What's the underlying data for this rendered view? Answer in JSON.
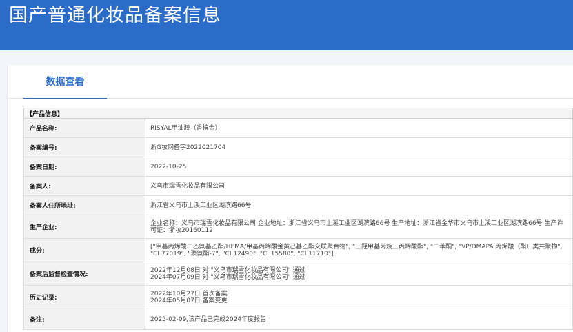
{
  "header": {
    "title": "国产普通化妆品备案信息"
  },
  "tabs": [
    {
      "label": "数据查看"
    }
  ],
  "section_title": "【产品信息】",
  "rows": [
    {
      "label": "产品名称:",
      "value": "RISYAL甲油胶（香槟金）"
    },
    {
      "label": "备案编号:",
      "value": "浙G妆网备字2022021704"
    },
    {
      "label": "备案日期:",
      "value": "2022-10-25"
    },
    {
      "label": "备案人:",
      "value": "义乌市瑞雪化妆品有限公司"
    },
    {
      "label": "备案人住所地址:",
      "value": "浙江省义乌市上溪工业区湖滨路66号"
    },
    {
      "label": "生产企业:",
      "value": "企业名称：义乌市瑞雪化妆品有限公司 企业地址：浙江省义乌市上溪工业区湖滨路66号 生产地址：浙江省金华市义乌市上溪工业区湖滨路66号 生产许可证：浙妆20160112"
    },
    {
      "label": "成分:",
      "value": "[\"甲基丙烯酸二乙氨基乙酯/HEMA/甲基丙烯酸金黄己基乙酯交联聚合物\", \"三羟甲基丙烷三丙烯酸酯\", \"二苯酮\", \"VP/DMAPA 丙烯酸（酯）类共聚物\", \"CI 77019\", \"聚氨酯-7\", \"CI 12490\", \"CI 15580\", \"CI 11710\"]"
    },
    {
      "label": "备案后监督检查情况:",
      "value": "2022年12月08日 对 \"义乌市瑞雪化妆品有限公司\" 通过\n2024年07月09日 对 \"义乌市瑞雪化妆品有限公司\" 通过"
    },
    {
      "label": "历史记录:",
      "value": "2022年10月27日 首次备案\n2024年05月07日 备案变更"
    },
    {
      "label": "备注:",
      "value": "2025-02-09,该产品已完成2024年度报告"
    }
  ]
}
